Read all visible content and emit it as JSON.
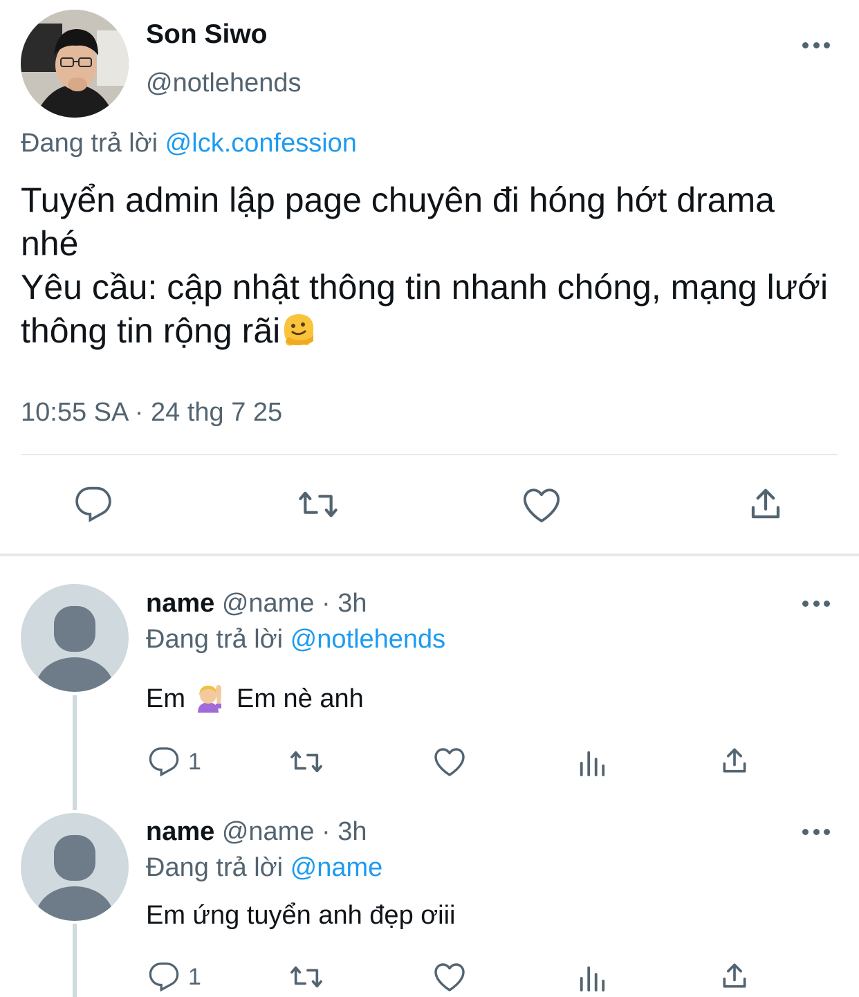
{
  "tweet": {
    "author_name": "Son Siwo",
    "author_handle": "@notlehends",
    "replying_prefix": "Đang trả lời",
    "replying_to": "@lck.confession",
    "text": "Tuyển admin lập page chuyên đi hóng hớt drama nhé\nYêu cầu: cập nhật thông tin nhanh chóng, mạng lưới thông tin rộng rãi",
    "emoji": "melting-face-emoji",
    "timestamp": "10:55 SA · 24 thg 7 25",
    "actions": [
      "reply-icon",
      "retweet-icon",
      "like-icon",
      "share-icon"
    ]
  },
  "replies": [
    {
      "name": "name",
      "handle": "@name",
      "time": "· 3h",
      "replying_prefix": "Đang trả lời",
      "replying_to": "@notlehends",
      "text_before": "Em",
      "emoji": "person-raising-hand-emoji",
      "text_after": "Em nè anh",
      "reply_count": "1"
    },
    {
      "name": "name",
      "handle": "@name",
      "time": "· 3h",
      "replying_prefix": "Đang trả lời",
      "replying_to": "@name",
      "text": "Em ứng tuyển anh đẹp ơiii",
      "reply_count": "1"
    }
  ],
  "colors": {
    "text": "#0f1419",
    "secondary": "#536471",
    "accent": "#1d9bf0",
    "divider": "#e6e9ec",
    "avatar_placeholder": "#cfd9de",
    "avatar_figure": "#6e7c89"
  }
}
